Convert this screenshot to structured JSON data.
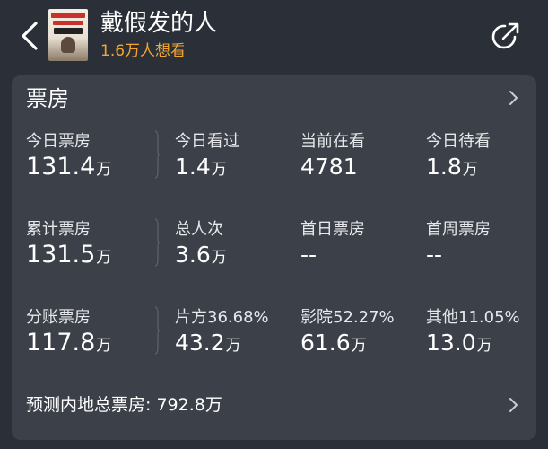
{
  "header": {
    "title": "戴假发的人",
    "want_to_see": "1.6万人想看",
    "icons": {
      "back": "back-chevron-icon",
      "share": "share-icon"
    }
  },
  "card": {
    "title": "票房",
    "rows": [
      [
        {
          "label": "今日票房",
          "value": "131.4",
          "unit": "万"
        },
        {
          "label": "今日看过",
          "value": "1.4",
          "unit": "万"
        },
        {
          "label": "当前在看",
          "value": "4781",
          "unit": ""
        },
        {
          "label": "今日待看",
          "value": "1.8",
          "unit": "万"
        }
      ],
      [
        {
          "label": "累计票房",
          "value": "131.5",
          "unit": "万"
        },
        {
          "label": "总人次",
          "value": "3.6",
          "unit": "万"
        },
        {
          "label": "首日票房",
          "value": "--",
          "unit": ""
        },
        {
          "label": "首周票房",
          "value": "--",
          "unit": ""
        }
      ],
      [
        {
          "label": "分账票房",
          "value": "117.8",
          "unit": "万"
        },
        {
          "label": "片方36.68%",
          "value": "43.2",
          "unit": "万"
        },
        {
          "label": "影院52.27%",
          "value": "61.6",
          "unit": "万"
        },
        {
          "label": "其他11.05%",
          "value": "13.0",
          "unit": "万"
        }
      ]
    ],
    "forecast": "预测内地总票房: 792.8万"
  },
  "colors": {
    "background": "#2b3038",
    "card": "#3b4049",
    "accent_orange": "#f2a530"
  }
}
